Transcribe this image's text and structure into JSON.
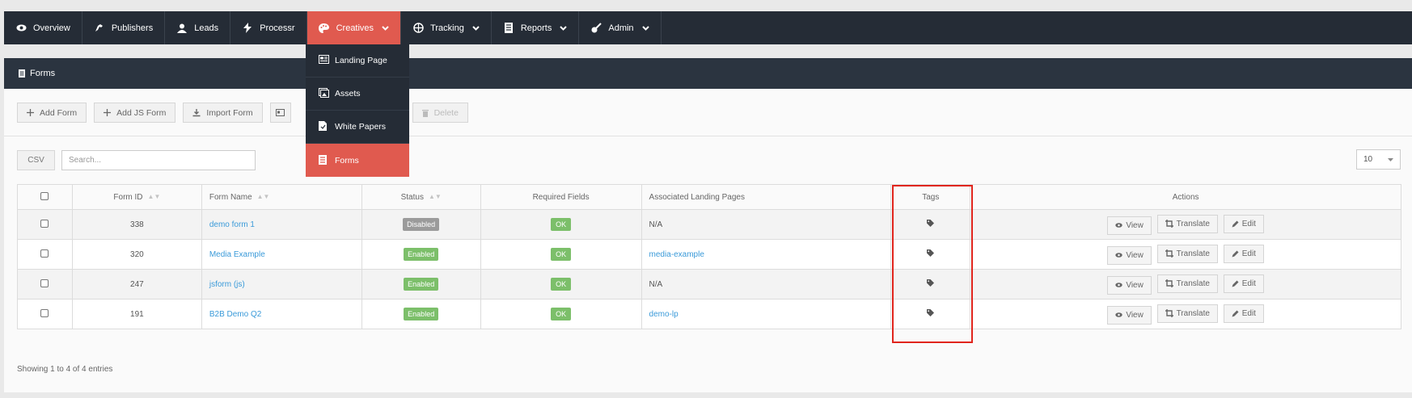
{
  "nav": {
    "items": [
      {
        "label": "Overview",
        "icon": "eye-icon"
      },
      {
        "label": "Publishers",
        "icon": "handshake-icon"
      },
      {
        "label": "Leads",
        "icon": "user-icon"
      },
      {
        "label": "Processr",
        "icon": "bolt-icon"
      },
      {
        "label": "Creatives",
        "icon": "palette-icon",
        "active": true
      },
      {
        "label": "Tracking",
        "icon": "globe-icon"
      },
      {
        "label": "Reports",
        "icon": "report-icon"
      },
      {
        "label": "Admin",
        "icon": "guitar-icon"
      }
    ]
  },
  "creatives_menu": {
    "items": [
      {
        "label": "Landing Page",
        "icon": "landing-page-icon"
      },
      {
        "label": "Assets",
        "icon": "assets-icon"
      },
      {
        "label": "White Papers",
        "icon": "file-icon"
      },
      {
        "label": "Forms",
        "icon": "form-icon",
        "active": true
      }
    ]
  },
  "panel": {
    "title": "Forms"
  },
  "toolbar": {
    "add_form": "Add Form",
    "add_js_form": "Add JS Form",
    "import_form": "Import Form",
    "delete": "Delete"
  },
  "controls": {
    "csv": "CSV",
    "search_placeholder": "Search...",
    "page_size": "10"
  },
  "table": {
    "headers": {
      "form_id": "Form ID",
      "form_name": "Form Name",
      "status": "Status",
      "required_fields": "Required Fields",
      "landing_pages": "Associated Landing Pages",
      "tags": "Tags",
      "actions": "Actions"
    },
    "rows": [
      {
        "id": "338",
        "name": "demo form 1",
        "status": "Disabled",
        "required": "OK",
        "landing": "N/A"
      },
      {
        "id": "320",
        "name": "Media Example",
        "status": "Enabled",
        "required": "OK",
        "landing": "media-example"
      },
      {
        "id": "247",
        "name": "jsform (js)",
        "status": "Enabled",
        "required": "OK",
        "landing": "N/A"
      },
      {
        "id": "191",
        "name": "B2B Demo Q2",
        "status": "Enabled",
        "required": "OK",
        "landing": "demo-lp"
      }
    ],
    "actions": {
      "view": "View",
      "translate": "Translate",
      "edit": "Edit"
    }
  },
  "footer": {
    "info": "Showing 1 to 4 of 4 entries"
  },
  "colors": {
    "nav_bg": "#252c36",
    "accent": "#e05a4f",
    "link": "#3a9ad9",
    "enabled": "#7cbf6a",
    "disabled": "#9b9b9b",
    "highlight": "#e0251d"
  }
}
